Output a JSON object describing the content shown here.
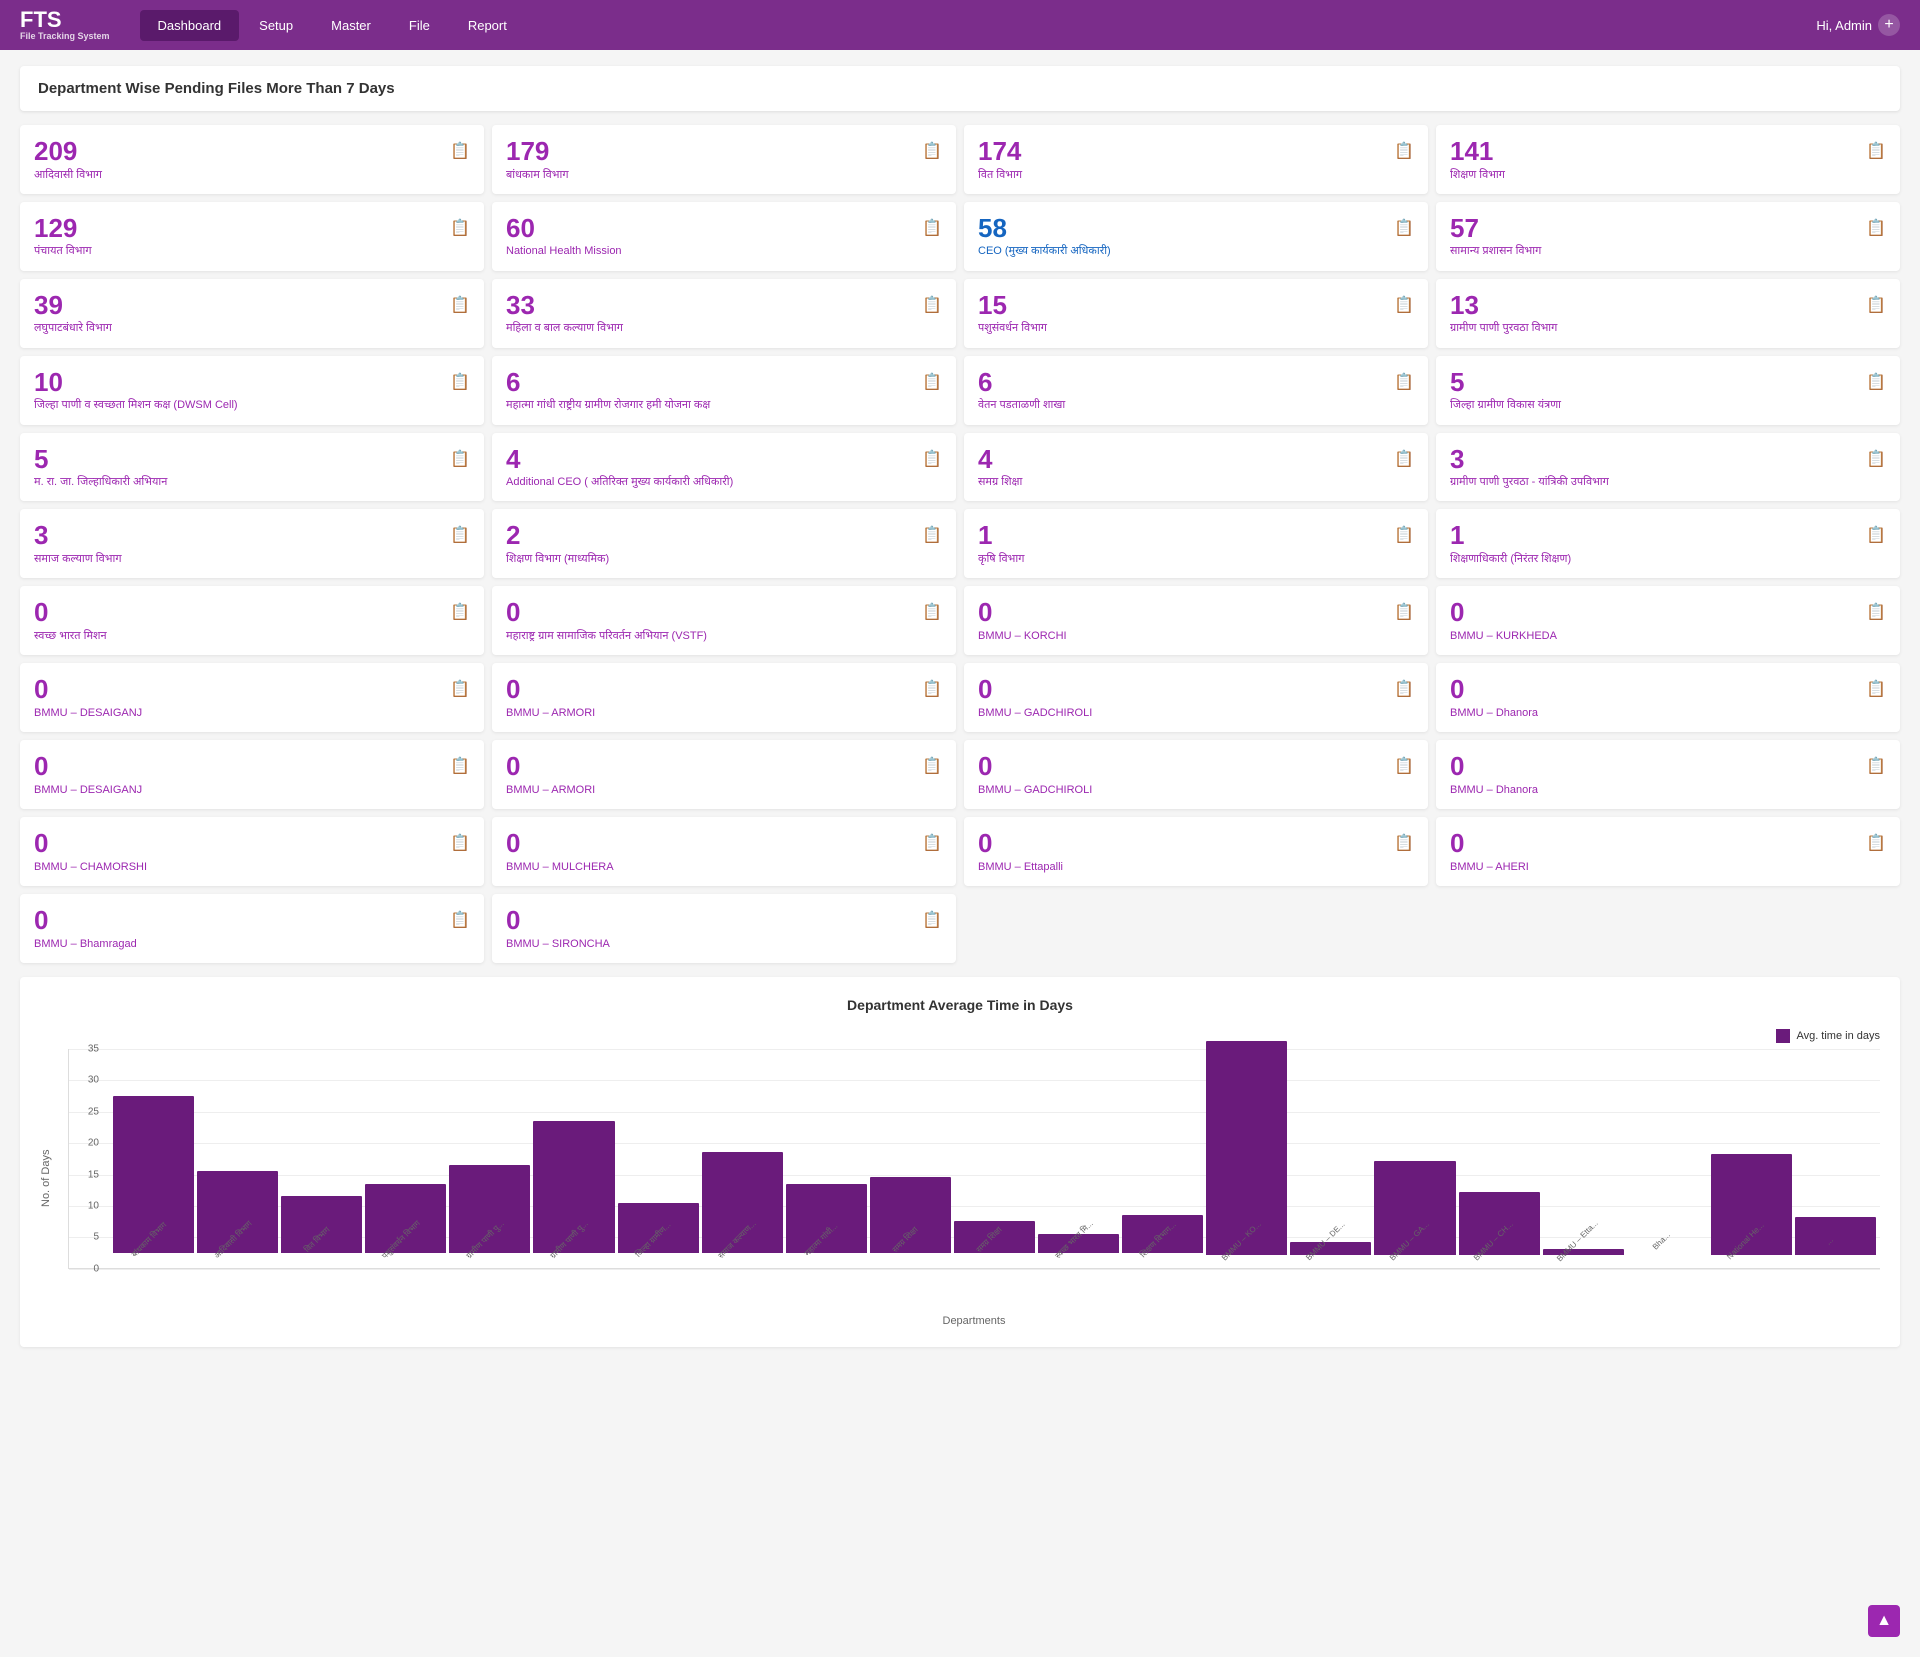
{
  "brand": {
    "main": "FTS",
    "sub": "File Tracking System"
  },
  "nav": {
    "links": [
      "Dashboard",
      "Setup",
      "Master",
      "File",
      "Report"
    ],
    "active": "Dashboard",
    "user": "Hi, Admin"
  },
  "page": {
    "title": "Department Wise Pending Files More Than 7 Days"
  },
  "stats": [
    {
      "number": "209",
      "label": "आदिवासी विभाग",
      "blue": false
    },
    {
      "number": "179",
      "label": "बांधकाम विभाग",
      "blue": false
    },
    {
      "number": "174",
      "label": "वित विभाग",
      "blue": false
    },
    {
      "number": "141",
      "label": "शिक्षण विभाग",
      "blue": false
    },
    {
      "number": "129",
      "label": "पंचायत विभाग",
      "blue": false
    },
    {
      "number": "60",
      "label": "National Health Mission",
      "blue": false
    },
    {
      "number": "58",
      "label": "CEO (मुख्य कार्यकारी अधिकारी)",
      "blue": true
    },
    {
      "number": "57",
      "label": "सामान्य प्रशासन विभाग",
      "blue": false
    },
    {
      "number": "39",
      "label": "लघुपाटबंधारे विभाग",
      "blue": false
    },
    {
      "number": "33",
      "label": "महिला व बाल कल्याण विभाग",
      "blue": false
    },
    {
      "number": "15",
      "label": "पशुसंवर्धन विभाग",
      "blue": false
    },
    {
      "number": "13",
      "label": "ग्रामीण पाणी पुरवठा विभाग",
      "blue": false
    },
    {
      "number": "10",
      "label": "जिल्हा पाणी व स्वच्छता मिशन कक्ष (DWSM Cell)",
      "blue": false
    },
    {
      "number": "6",
      "label": "महात्मा गांधी राष्ट्रीय ग्रामीण रोजगार हमी योजना कक्ष",
      "blue": false
    },
    {
      "number": "6",
      "label": "वेतन पडताळणी शाखा",
      "blue": false
    },
    {
      "number": "5",
      "label": "जिल्हा ग्रामीण विकास यंत्रणा",
      "blue": false
    },
    {
      "number": "5",
      "label": "म. रा. जा. जिल्हाधिकारी अभियान",
      "blue": false
    },
    {
      "number": "4",
      "label": "Additional CEO ( अतिरिक्त मुख्य कार्यकारी अधिकारी)",
      "blue": false
    },
    {
      "number": "4",
      "label": "समग्र शिक्षा",
      "blue": false
    },
    {
      "number": "3",
      "label": "ग्रामीण पाणी पुरवठा - यांत्रिकी उपविभाग",
      "blue": false
    },
    {
      "number": "3",
      "label": "समाज कल्याण विभाग",
      "blue": false
    },
    {
      "number": "2",
      "label": "शिक्षण विभाग (माध्यमिक)",
      "blue": false
    },
    {
      "number": "1",
      "label": "कृषि विभाग",
      "blue": false
    },
    {
      "number": "1",
      "label": "शिक्षणाधिकारी (निरंतर शिक्षण)",
      "blue": false
    },
    {
      "number": "0",
      "label": "स्वच्छ भारत मिशन",
      "blue": false
    },
    {
      "number": "0",
      "label": "महाराष्ट्र ग्राम सामाजिक परिवर्तन अभियान (VSTF)",
      "blue": false
    },
    {
      "number": "0",
      "label": "BMMU – KORCHI",
      "blue": false
    },
    {
      "number": "0",
      "label": "BMMU – KURKHEDA",
      "blue": false
    },
    {
      "number": "0",
      "label": "BMMU – DESAIGANJ",
      "blue": false
    },
    {
      "number": "0",
      "label": "BMMU – ARMORI",
      "blue": false
    },
    {
      "number": "0",
      "label": "BMMU – GADCHIROLI",
      "blue": false
    },
    {
      "number": "0",
      "label": "BMMU – Dhanora",
      "blue": false
    },
    {
      "number": "0",
      "label": "BMMU – DESAIGANJ",
      "blue": false
    },
    {
      "number": "0",
      "label": "BMMU – ARMORI",
      "blue": false
    },
    {
      "number": "0",
      "label": "BMMU – GADCHIROLI",
      "blue": false
    },
    {
      "number": "0",
      "label": "BMMU – Dhanora",
      "blue": false
    },
    {
      "number": "0",
      "label": "BMMU – CHAMORSHI",
      "blue": false
    },
    {
      "number": "0",
      "label": "BMMU – MULCHERA",
      "blue": false
    },
    {
      "number": "0",
      "label": "BMMU – Ettapalli",
      "blue": false
    },
    {
      "number": "0",
      "label": "BMMU – AHERI",
      "blue": false
    },
    {
      "number": "0",
      "label": "BMMU – Bhamragad",
      "blue": false
    },
    {
      "number": "0",
      "label": "BMMU – SIRONCHA",
      "blue": false
    }
  ],
  "chart": {
    "title": "Department Average Time in Days",
    "y_label": "No. of Days",
    "x_label": "Departments",
    "legend": "Avg. time in days",
    "y_max": 35,
    "y_ticks": [
      35,
      30,
      25,
      20,
      15,
      10,
      5,
      0
    ],
    "bars": [
      {
        "label": "बांधकाम विभाग",
        "value": 25
      },
      {
        "label": "आदिवासी विभाग",
        "value": 13
      },
      {
        "label": "वित विभाग",
        "value": 9
      },
      {
        "label": "पशुसंवर्धन विभाग",
        "value": 11
      },
      {
        "label": "ग्रामीण पाणी पु...",
        "value": 14
      },
      {
        "label": "ग्रामीण पाणी पु...",
        "value": 21
      },
      {
        "label": "जिल्हा ग्रामीण...",
        "value": 8
      },
      {
        "label": "समाज कल्याण...",
        "value": 16
      },
      {
        "label": "महात्मा गांधी...",
        "value": 11
      },
      {
        "label": "समग्र शिक्षा",
        "value": 12
      },
      {
        "label": "समग्र शिक्षा",
        "value": 5
      },
      {
        "label": "स्वच्छ भारत मि...",
        "value": 3
      },
      {
        "label": "शिक्षण विभाग...",
        "value": 6
      },
      {
        "label": "BMMU – KO...",
        "value": 34
      },
      {
        "label": "BMMU – DE...",
        "value": 2
      },
      {
        "label": "BMMU – GA...",
        "value": 15
      },
      {
        "label": "BMMU – CH...",
        "value": 10
      },
      {
        "label": "BMMU – Etta...",
        "value": 1
      },
      {
        "label": "Bha...",
        "value": 0
      },
      {
        "label": "National He...",
        "value": 16
      },
      {
        "label": "...",
        "value": 6
      }
    ]
  }
}
